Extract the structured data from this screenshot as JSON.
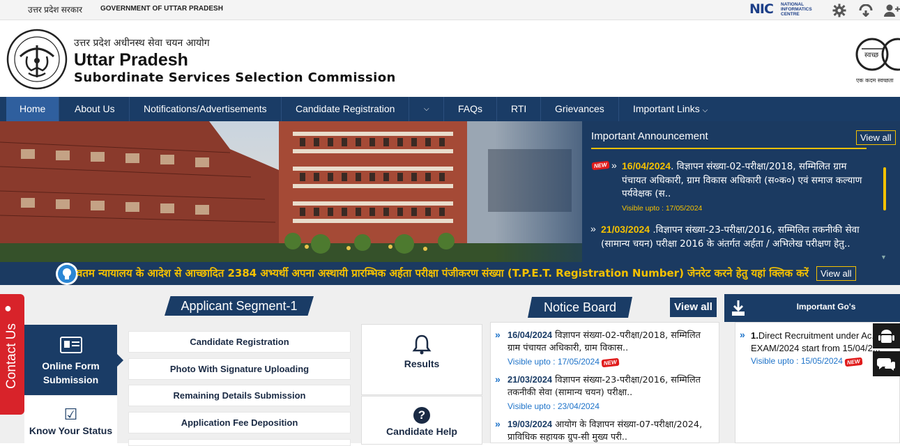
{
  "topbar": {
    "hindi_label": "उत्तर प्रदेश सरकार",
    "english_label": "GOVERNMENT OF UTTAR PRADESH",
    "nic_logo": {
      "abbr": "NIC",
      "line1": "NATIONAL",
      "line2": "INFORMATICS",
      "line3": "CENTRE"
    },
    "icons": [
      "gear-icon",
      "accessibility-icon",
      "user-add-icon"
    ]
  },
  "header": {
    "hindi_title": "उत्तर प्रदेश अधीनस्थ सेवा चयन आयोग",
    "title": "Uttar Pradesh",
    "subtitle": "Subordinate Services Selection Commission",
    "swachh_text": "स्वच्छ",
    "swachh_tagline": "एक कदम स्वच्छता"
  },
  "nav": {
    "items": [
      "Home",
      "About Us",
      "Notifications/Advertisements",
      "Candidate Registration",
      "",
      "FAQs",
      "RTI",
      "Grievances",
      "Important Links"
    ],
    "active": "Home"
  },
  "announcement": {
    "title": "Important Announcement",
    "view_all": "View all",
    "items": [
      {
        "date": "16/04/2024",
        "text": ". विज्ञापन संख्या-02-परीक्षा/2018, सम्मिलित ग्राम पंचायत अधिकारी, ग्राम विकास अधिकारी (स०क०) एवं समाज कल्याण पर्यवेक्षक (स..",
        "visible": "Visible upto : 17/05/2024",
        "new": "NEW"
      },
      {
        "date": "21/03/2024",
        "text": " .विज्ञापन संख्या-23-परीक्षा/2016, सम्मिलित तकनीकी सेवा (सामान्य चयन) परीक्षा 2016 के अंतर्गत अर्हता / अभिलेख परीक्षण हेतु.."
      }
    ]
  },
  "ticker": {
    "text": "वतम न्यायालय के आदेश से आच्छादित 2384 अभ्यर्थी अपना अस्थायी प्रारम्भिक अर्हता परीक्षा पंजीकरण संख्या (T.P.E.T. Registration Number) जेनरेट करने हेतु यहां क्लिक करें",
    "view_all": "View all"
  },
  "contact": {
    "label": "Contact Us"
  },
  "applicant": {
    "heading": "Applicant Segment-1",
    "online_form": "Online Form Submission",
    "know_status": "Know Your Status",
    "steps": [
      "Candidate Registration",
      "Photo With Signature Uploading",
      "Remaining Details Submission",
      "Application Fee Deposition"
    ],
    "cards": [
      {
        "label": "Results",
        "icon": "bell-icon"
      },
      {
        "label": "Candidate Help",
        "icon": "question-icon"
      }
    ]
  },
  "notice_board": {
    "heading": "Notice Board",
    "view_all": "View all",
    "items": [
      {
        "date": "16/04/2024",
        "text": " विज्ञापन संख्या-02-परीक्षा/2018, सम्मिलित ग्राम पंचायत अधिकारी, ग्राम विकास..",
        "visible": "Visible upto : 17/05/2024",
        "new": "NEW"
      },
      {
        "date": "21/03/2024",
        "text": " विज्ञापन संख्या-23-परीक्षा/2016, सम्मिलित तकनीकी सेवा (सामान्य चयन) परीक्षा..",
        "visible": "Visible upto : 23/04/2024"
      },
      {
        "date": "19/03/2024",
        "text": " आयोग के विज्ञापन संख्या-07-परीक्षा/2024, प्राविधिक सहायक ग्रुप-सी मुख्य परी.."
      }
    ]
  },
  "important_gos": {
    "heading": "Important Go's",
    "items": [
      {
        "num": "1.",
        "text": "Direct Recruitment under Ac... EXAM/2024 start from 15/04/2...",
        "visible": "Visible upto : 15/05/2024",
        "new": "NEW"
      }
    ]
  },
  "colors": {
    "navy": "#1a3c66",
    "gold": "#f5c100",
    "red": "#d8232a",
    "link_blue": "#1e73c9"
  }
}
